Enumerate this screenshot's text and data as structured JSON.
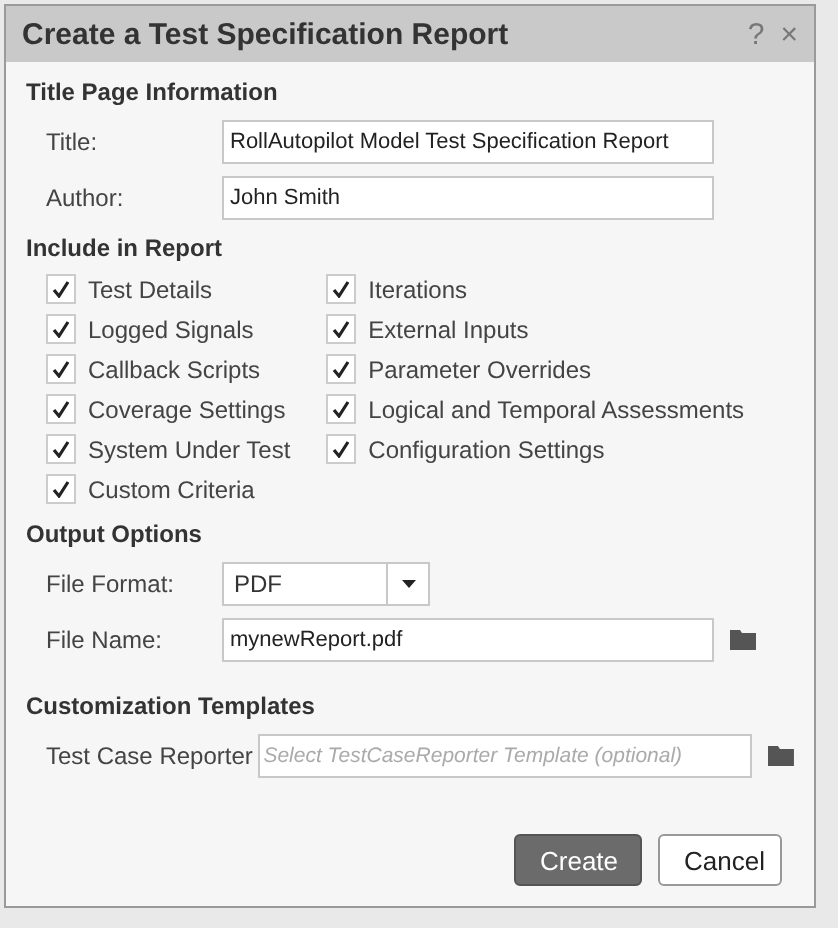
{
  "window": {
    "title": "Create a Test Specification Report",
    "help": "?",
    "close": "×"
  },
  "title_page": {
    "heading": "Title Page Information",
    "fields": [
      {
        "label": "Title:",
        "value": "RollAutopilot Model Test Specification Report"
      },
      {
        "label": "Author:",
        "value": "John Smith"
      }
    ]
  },
  "include": {
    "heading": "Include in Report",
    "columns": [
      [
        {
          "label": "Test Details",
          "checked": true
        },
        {
          "label": "Logged Signals",
          "checked": true
        },
        {
          "label": "Callback Scripts",
          "checked": true
        },
        {
          "label": "Coverage Settings",
          "checked": true
        },
        {
          "label": "System Under Test",
          "checked": true
        },
        {
          "label": "Custom Criteria",
          "checked": true
        }
      ],
      [
        {
          "label": "Iterations",
          "checked": true
        },
        {
          "label": "External Inputs",
          "checked": true
        },
        {
          "label": "Parameter Overrides",
          "checked": true
        },
        {
          "label": "Logical and Temporal Assessments",
          "checked": true
        },
        {
          "label": "Configuration Settings",
          "checked": true
        }
      ]
    ]
  },
  "output": {
    "heading": "Output Options",
    "file_format": {
      "label": "File Format:",
      "value": "PDF"
    },
    "file_name": {
      "label": "File Name:",
      "value": "mynewReport.pdf"
    }
  },
  "templates": {
    "heading": "Customization Templates",
    "test_case_reporter": {
      "label": "Test Case Reporter",
      "placeholder": "Select TestCaseReporter Template (optional)"
    }
  },
  "buttons": [
    {
      "label": "Create",
      "kind": "primary"
    },
    {
      "label": "Cancel",
      "kind": "secondary"
    }
  ]
}
